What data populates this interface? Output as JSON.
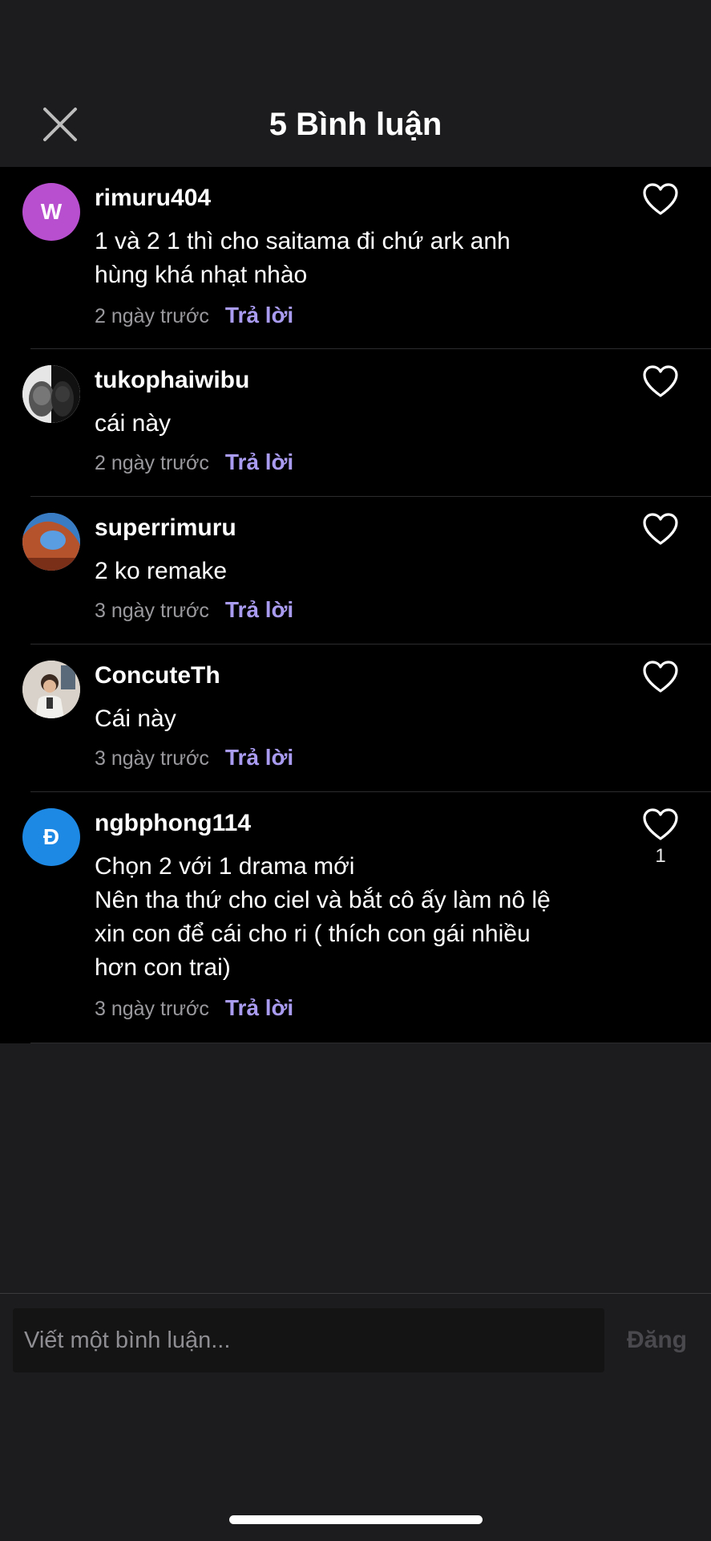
{
  "header": {
    "title": "5 Bình luận",
    "close_icon": "close-icon"
  },
  "comments": [
    {
      "username": "rimuru404",
      "avatar_letter": "W",
      "avatar_color": "#b84fcf",
      "text": "1 và 2 1 thì cho saitama đi  chứ ark anh\nhùng khá nhạt nhào",
      "time": "2 ngày trước",
      "reply_label": "Trả lời"
    },
    {
      "username": "tukophaiwibu",
      "avatar_letter": "",
      "text": "cái này",
      "time": "2 ngày trước",
      "reply_label": "Trả lời"
    },
    {
      "username": "superrimuru",
      "avatar_letter": "",
      "text": "2 ko remake",
      "time": "3 ngày trước",
      "reply_label": "Trả lời"
    },
    {
      "username": "ConcuteTh",
      "avatar_letter": "",
      "text": "Cái này",
      "time": "3 ngày trước",
      "reply_label": "Trả lời"
    },
    {
      "username": "ngbphong114",
      "avatar_letter": "Đ",
      "avatar_color": "#1e88e5",
      "text": "Chọn 2 với 1 drama mới\nNên tha thứ cho ciel và bắt cô ấy làm nô lệ\nxin con để cái cho ri ( thích con gái nhiều\nhơn con trai)",
      "time": "3 ngày trước",
      "reply_label": "Trả lời",
      "like_count": "1"
    }
  ],
  "composer": {
    "placeholder": "Viết một bình luận...",
    "post_label": "Đăng"
  },
  "colors": {
    "accent": "#a99cf0",
    "background": "#1c1c1e",
    "list_background": "#000000"
  }
}
